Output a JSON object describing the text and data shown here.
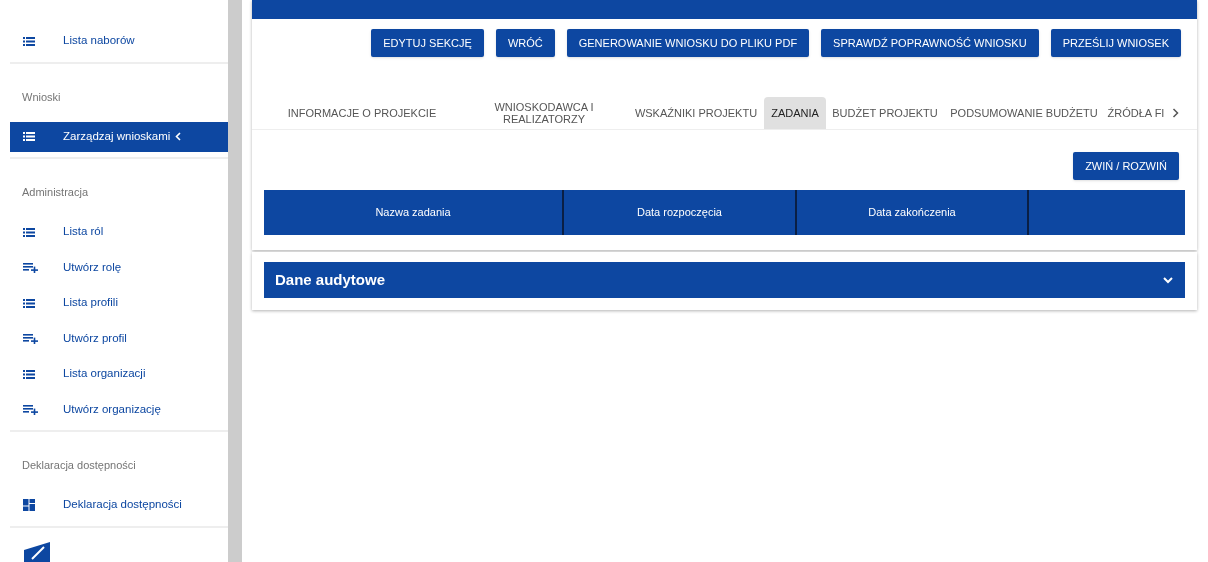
{
  "sidebar": {
    "sections": [
      {
        "items": [
          {
            "label": "Lista naborów",
            "kind": "list",
            "selected": false,
            "chevron": false
          }
        ]
      },
      {
        "title": "Wnioski",
        "items": [
          {
            "label": "Zarządzaj wnioskami",
            "kind": "list",
            "selected": true,
            "chevron": true
          }
        ]
      },
      {
        "title": "Administracja",
        "items": [
          {
            "label": "Lista ról",
            "kind": "list",
            "selected": false,
            "chevron": false
          },
          {
            "label": "Utwórz rolę",
            "kind": "create",
            "selected": false,
            "chevron": false
          },
          {
            "label": "Lista profili",
            "kind": "list",
            "selected": false,
            "chevron": false
          },
          {
            "label": "Utwórz profil",
            "kind": "create",
            "selected": false,
            "chevron": false
          },
          {
            "label": "Lista organizacji",
            "kind": "list",
            "selected": false,
            "chevron": false
          },
          {
            "label": "Utwórz organizację",
            "kind": "create",
            "selected": false,
            "chevron": false
          }
        ]
      },
      {
        "title": "Deklaracja dostępności",
        "items": [
          {
            "label": "Deklaracja dostępności",
            "kind": "page",
            "selected": false,
            "chevron": false
          }
        ]
      }
    ]
  },
  "actions": [
    "EDYTUJ SEKCJĘ",
    "WRÓĆ",
    "GENEROWANIE WNIOSKU DO PLIKU PDF",
    "SPRAWDŹ POPRAWNOŚĆ WNIOSKU",
    "PRZEŚLIJ WNIOSEK"
  ],
  "tabs": [
    {
      "label": "INFORMACJE O PROJEKCIE",
      "selected": false
    },
    {
      "label": "WNIOSKODAWCA I REALIZATORZY",
      "selected": false
    },
    {
      "label": "WSKAŹNIKI PROJEKTU",
      "selected": false
    },
    {
      "label": "ZADANIA",
      "selected": true
    },
    {
      "label": "BUDŻET PROJEKTU",
      "selected": false
    },
    {
      "label": "PODSUMOWANIE BUDŻETU",
      "selected": false
    },
    {
      "label": "ŹRÓDŁA FI",
      "selected": false
    }
  ],
  "collapse_button": "ZWIŃ / ROZWIŃ",
  "table": {
    "columns": [
      "Nazwa zadania",
      "Data rozpoczęcia",
      "Data zakończenia",
      ""
    ]
  },
  "audit_panel": {
    "title": "Dane audytowe",
    "expanded": false
  }
}
